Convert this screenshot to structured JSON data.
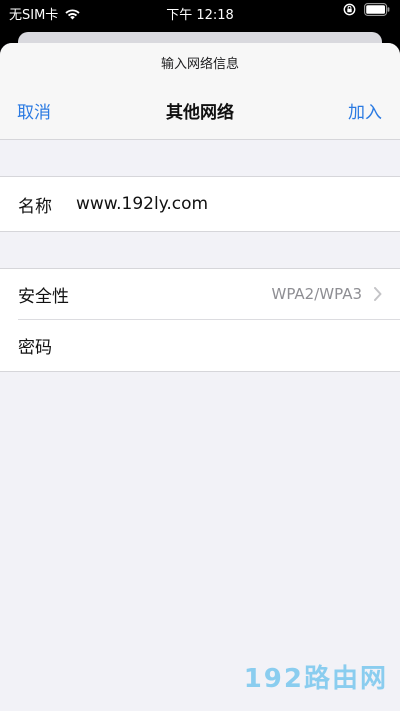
{
  "status_bar": {
    "carrier": "无SIM卡",
    "time": "下午 12:18"
  },
  "sheet": {
    "prompt": "输入网络信息",
    "title": "其他网络",
    "cancel_label": "取消",
    "join_label": "加入"
  },
  "fields": {
    "name_label": "名称",
    "name_value": "www.192ly.com",
    "security_label": "安全性",
    "security_value": "WPA2/WPA3",
    "password_label": "密码"
  },
  "watermark": "192路由网",
  "colors": {
    "accent": "#2a7ae2",
    "background": "#f2f2f7",
    "secondary_text": "#8e8e93",
    "watermark": "#7fc9ef"
  },
  "icons": [
    "wifi-icon",
    "lock-rotation-icon",
    "battery-icon",
    "chevron-right-icon"
  ]
}
